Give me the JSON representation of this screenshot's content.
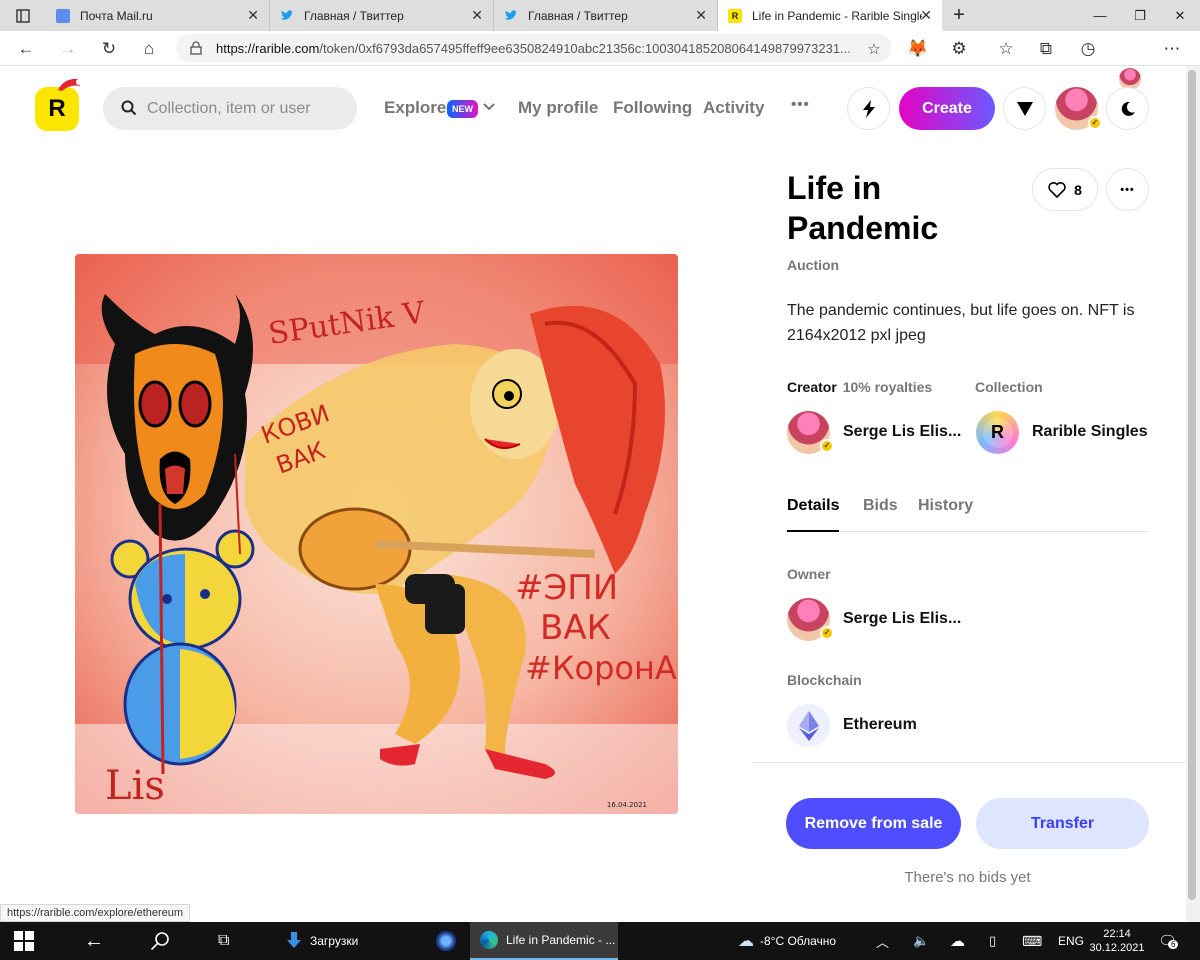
{
  "browser": {
    "tabs": [
      {
        "title": "Почта Mail.ru",
        "favicon_color": "#5a8dee"
      },
      {
        "title": "Главная / Твиттер",
        "favicon_color": "#1d9bf0"
      },
      {
        "title": "Главная / Твиттер",
        "favicon_color": "#1d9bf0"
      },
      {
        "title": "Life in Pandemic - Rarible Singles",
        "favicon_color": "#fee500"
      }
    ],
    "new_tab_label": "+",
    "url_domain": "https://rarible.com",
    "url_path": "/token/0xf6793da657495ffeff9ee6350824910abc21356c:100304185208064149879973231...",
    "status_url": "https://rarible.com/explore/ethereum"
  },
  "header": {
    "logo_letter": "R",
    "search_placeholder": "Collection, item or user",
    "nav": {
      "explore": "Explore",
      "new_badge": "NEW",
      "my_profile": "My profile",
      "following": "Following",
      "activity": "Activity",
      "more": "•••"
    },
    "create_label": "Create"
  },
  "token": {
    "title": "Life in Pandemic",
    "like_count": "8",
    "more": "•••",
    "status": "Auction",
    "description": "The pandemic continues, but life goes on. NFT is 2164x2012 pxl jpeg",
    "creator_label": "Creator",
    "royalties": "10% royalties",
    "creator_name": "Serge Lis Elis...",
    "collection_label": "Collection",
    "collection_name": "Rarible Singles",
    "collection_logo_letter": "R",
    "tabs": [
      "Details",
      "Bids",
      "History"
    ],
    "owner_label": "Owner",
    "owner_name": "Serge Lis Elis...",
    "blockchain_label": "Blockchain",
    "blockchain_name": "Ethereum",
    "remove_label": "Remove from sale",
    "transfer_label": "Transfer",
    "no_bids": "There's no bids yet"
  },
  "artwork": {
    "text_sputnik": "SPutNik V",
    "text_kovid": "КОВИ",
    "text_vak": "ВАК",
    "text_epi": "#ЭПИ",
    "text_vak2": "ВАК",
    "text_korona": "#КоронА",
    "signature": "Lis",
    "date": "16.04.2021"
  },
  "taskbar": {
    "downloads": "Загрузки",
    "active_app": "Life in Pandemic - ...",
    "weather": "-8°C  Облачно",
    "lang": "ENG",
    "time": "22:14",
    "date": "30.12.2021",
    "notifications": "6"
  }
}
